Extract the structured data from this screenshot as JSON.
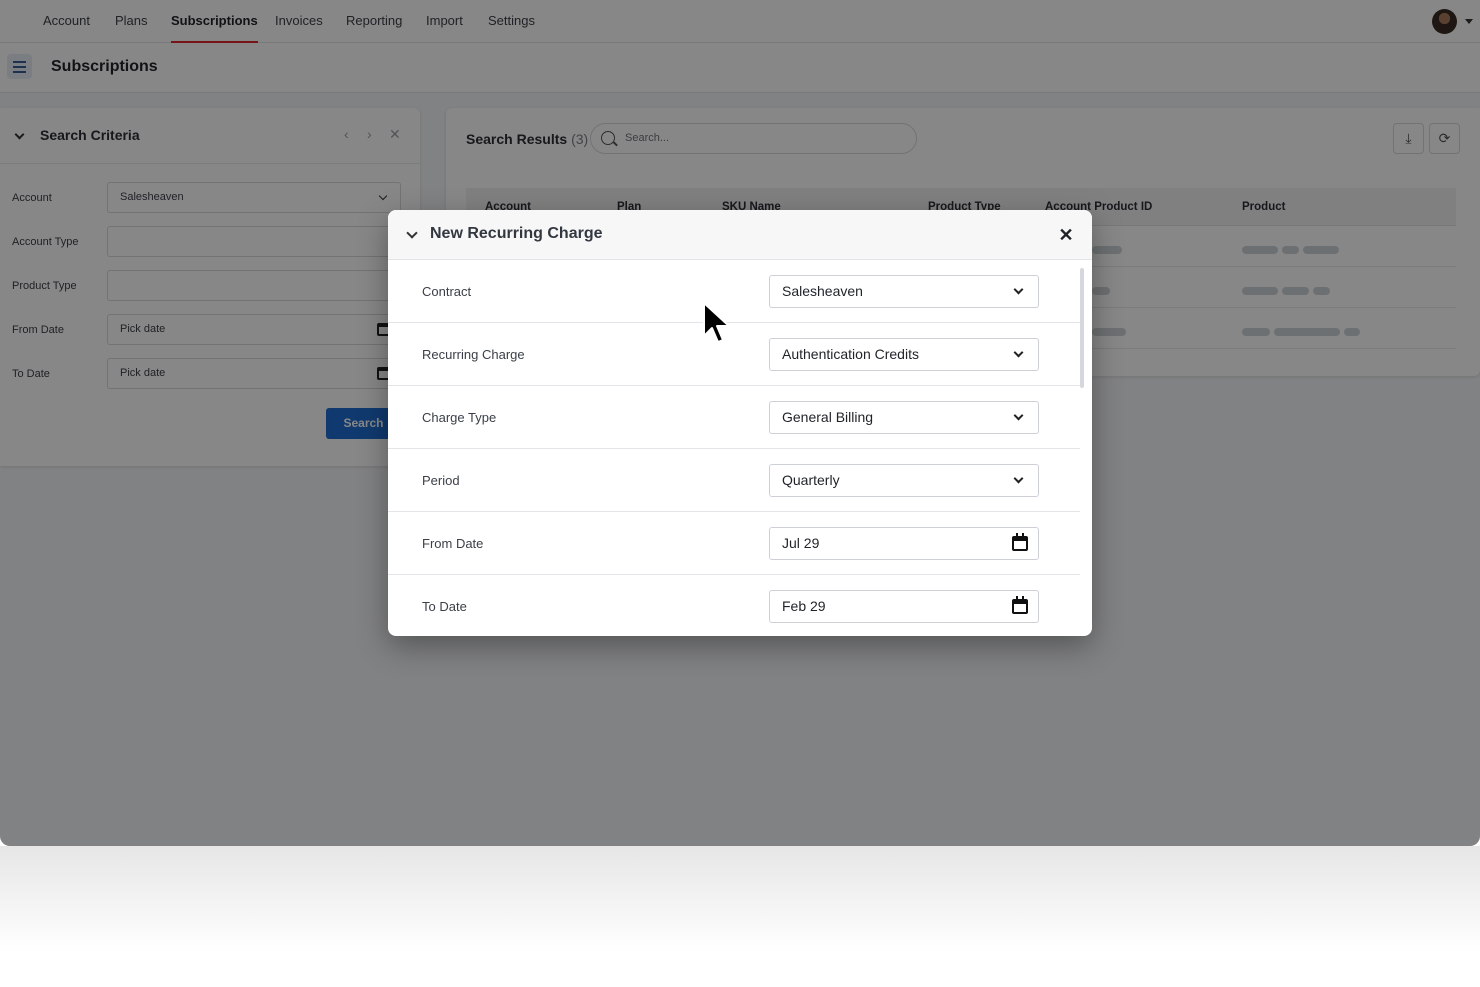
{
  "topnav": {
    "tabs": [
      {
        "label": "Account"
      },
      {
        "label": "Plans"
      },
      {
        "label": "Subscriptions"
      },
      {
        "label": "Invoices"
      },
      {
        "label": "Reporting"
      },
      {
        "label": "Import"
      },
      {
        "label": "Settings"
      }
    ],
    "active_tab": "Subscriptions"
  },
  "subheader": {
    "title": "Subscriptions"
  },
  "criteria": {
    "title": "Search Criteria",
    "fields": [
      {
        "label": "Account",
        "value": "Salesheaven"
      },
      {
        "label": "Account Type",
        "value": ""
      },
      {
        "label": "Product Type",
        "value": ""
      },
      {
        "label": "From Date",
        "value": "Pick date"
      },
      {
        "label": "To Date",
        "value": "Pick date"
      }
    ],
    "search_label": "Search"
  },
  "results": {
    "title": "Search Results",
    "count": "(3)",
    "search_placeholder": "Search...",
    "columns": [
      "Account",
      "Plan",
      "SKU Name",
      "Product Type",
      "Account Product ID",
      "Product"
    ]
  },
  "modal": {
    "title": "New Recurring Charge",
    "rows": [
      {
        "label": "Contract",
        "value": "Salesheaven",
        "kind": "select"
      },
      {
        "label": "Recurring Charge",
        "value": "Authentication Credits",
        "kind": "select"
      },
      {
        "label": "Charge Type",
        "value": "General Billing",
        "kind": "select"
      },
      {
        "label": "Period",
        "value": "Quarterly",
        "kind": "select"
      },
      {
        "label": "From Date",
        "value": "Jul 29",
        "kind": "date"
      },
      {
        "label": "To Date",
        "value": "Feb 29",
        "kind": "date"
      }
    ]
  },
  "colors": {
    "accent": "#e0262b",
    "primary_button": "#1f6fd1",
    "overlay": "rgba(0,0,0,0.47)"
  },
  "icons": [
    "menu-icon",
    "chevron-down-icon",
    "chevron-left-icon",
    "chevron-right-icon",
    "close-icon",
    "calendar-icon",
    "search-icon",
    "download-icon",
    "refresh-icon",
    "mouse-cursor"
  ]
}
